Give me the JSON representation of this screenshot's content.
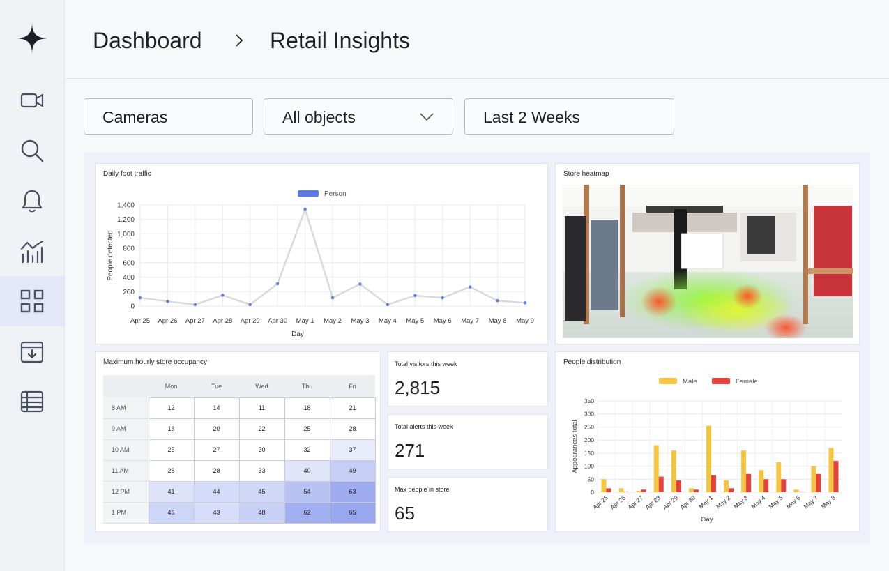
{
  "breadcrumb": {
    "root": "Dashboard",
    "current": "Retail Insights"
  },
  "filters": {
    "cameras": "Cameras",
    "objects": "All objects",
    "range": "Last 2 Weeks"
  },
  "nav": [
    "camera-icon",
    "search-icon",
    "bell-icon",
    "analytics-icon",
    "dashboard-grid-icon",
    "archive-icon",
    "table-icon"
  ],
  "colors": {
    "accent": "#5b7be6",
    "male": "#f5c542",
    "female": "#e5413d",
    "active_nav": "#e3e7f7"
  },
  "foot_traffic": {
    "title": "Daily foot traffic",
    "chart_data": {
      "type": "line",
      "title": "Daily foot traffic",
      "xlabel": "Day",
      "ylabel": "People detected",
      "legend": [
        "Person"
      ],
      "categories": [
        "Apr 25",
        "Apr 26",
        "Apr 27",
        "Apr 28",
        "Apr 29",
        "Apr 30",
        "May 1",
        "May 2",
        "May 3",
        "May 4",
        "May 5",
        "May 6",
        "May 7",
        "May 8",
        "May 9"
      ],
      "series": [
        {
          "name": "Person",
          "values": [
            115,
            65,
            20,
            150,
            20,
            310,
            1340,
            115,
            305,
            20,
            145,
            115,
            265,
            75,
            45
          ]
        }
      ],
      "ylim": [
        0,
        1400
      ],
      "yticks": [
        "0",
        "200",
        "400",
        "600",
        "800",
        "1,000",
        "1,200",
        "1,400"
      ],
      "grid": true
    }
  },
  "heatmap": {
    "title": "Store heatmap"
  },
  "occupancy": {
    "title": "Maximum hourly store occupancy",
    "days": [
      "Mon",
      "Tue",
      "Wed",
      "Thu",
      "Fri"
    ],
    "rows": [
      {
        "hour": "8 AM",
        "values": [
          12,
          14,
          11,
          18,
          21
        ]
      },
      {
        "hour": "9 AM",
        "values": [
          18,
          20,
          22,
          25,
          28
        ]
      },
      {
        "hour": "10 AM",
        "values": [
          25,
          27,
          30,
          32,
          37
        ]
      },
      {
        "hour": "11 AM",
        "values": [
          28,
          28,
          33,
          40,
          49
        ]
      },
      {
        "hour": "12 PM",
        "values": [
          41,
          44,
          45,
          54,
          63
        ]
      },
      {
        "hour": "1 PM",
        "values": [
          46,
          43,
          48,
          62,
          65
        ]
      }
    ]
  },
  "stats": [
    {
      "label": "Total visitors this week",
      "value": "2,815"
    },
    {
      "label": "Total alerts this week",
      "value": "271"
    },
    {
      "label": "Max people in store",
      "value": "65"
    }
  ],
  "distribution": {
    "title": "People distribution",
    "chart_data": {
      "type": "bar",
      "title": "People distribution",
      "xlabel": "Day",
      "ylabel": "Appearances total",
      "categories": [
        "Apr 25",
        "Apr 26",
        "Apr 27",
        "Apr 28",
        "Apr 29",
        "Apr 30",
        "May 1",
        "May 2",
        "May 3",
        "May 4",
        "May 5",
        "May 6",
        "May 7",
        "May 8"
      ],
      "series": [
        {
          "name": "Male",
          "values": [
            50,
            15,
            5,
            180,
            160,
            15,
            255,
            45,
            160,
            85,
            115,
            10,
            100,
            170
          ]
        },
        {
          "name": "Female",
          "values": [
            15,
            2,
            10,
            60,
            45,
            10,
            65,
            15,
            70,
            50,
            50,
            2,
            70,
            120
          ]
        }
      ],
      "ylim": [
        0,
        350
      ],
      "yticks": [
        "0",
        "50",
        "100",
        "150",
        "200",
        "250",
        "300",
        "350"
      ],
      "grid": true
    }
  }
}
